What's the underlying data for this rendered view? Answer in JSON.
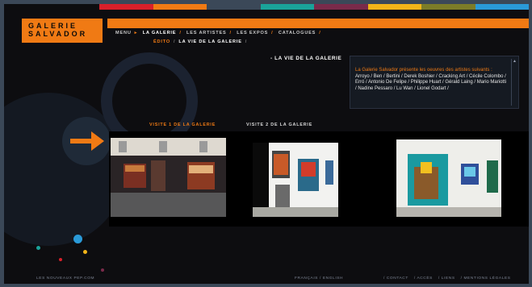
{
  "colors": {
    "accent": "#f07a14",
    "stripe": [
      "#d9202a",
      "#f07a14",
      "#3b4858",
      "#1aa39a",
      "#7a2a4a",
      "#f2b418",
      "#7c7c28",
      "#2a9ad8"
    ]
  },
  "logo": {
    "line1": "GALERIE",
    "line2": "SALVADOR"
  },
  "nav": {
    "menu": "MENU",
    "items": [
      "LA GALERIE",
      "LES ARTISTES",
      "LES EXPOS",
      "CATALOGUES"
    ]
  },
  "subnav": {
    "first": "ÉDITO",
    "current": "LA VIE DE LA GALERIE"
  },
  "page_heading": "- LA VIE DE LA GALERIE",
  "intro": {
    "lead": "La Galerie Salvador présente les oeuvres des artistes suivants :",
    "names": "Arroyo / Ben / Bertini / Derek Boshier / Cracking Art / Cécile Colombo / Erró / Antonio De Felipe / Philippe Huart / Gérald Laing / Mario Mariotti / Nadine Pessaro / Lu Wan / Lionel Godart /"
  },
  "visites": {
    "first": "VISITE 1 DE LA GALERIE",
    "second": "VISITE 2 DE LA GALERIE"
  },
  "footer": {
    "left": "LES NOUVEAUX PEP.COM",
    "mid": "FRANÇAIS / ENGLISH",
    "right": [
      "/ CONTACT",
      "/ ACCÈS",
      "/ LIENS",
      "/ MENTIONS LÉGALES"
    ]
  }
}
